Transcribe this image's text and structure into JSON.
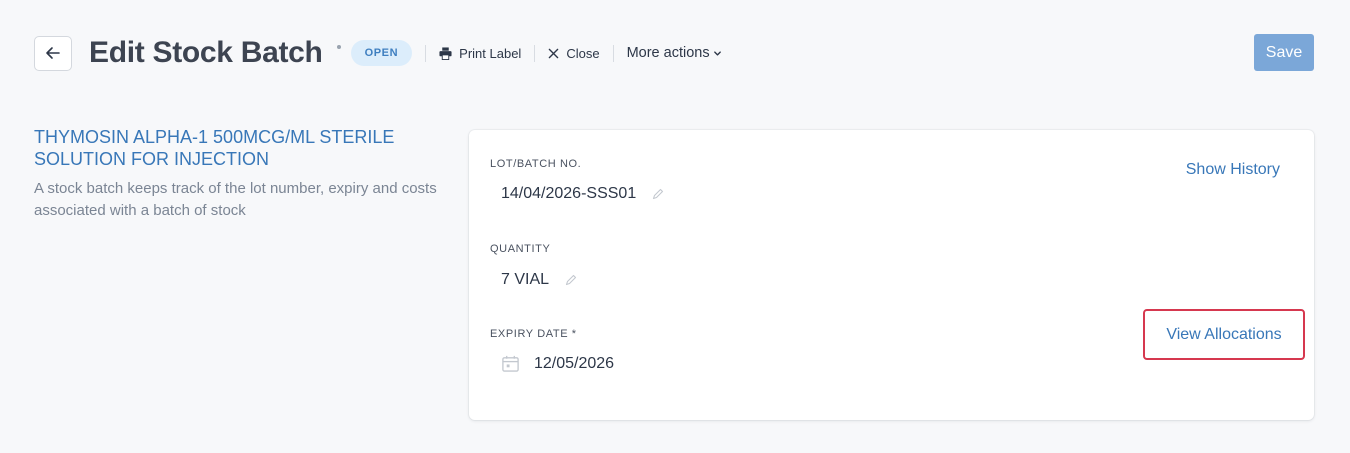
{
  "header": {
    "title": "Edit Stock Batch",
    "status": "OPEN",
    "actions": {
      "print_label": "Print Label",
      "close": "Close",
      "more_actions": "More actions"
    },
    "save_label": "Save"
  },
  "product": {
    "name": "THYMOSIN ALPHA-1 500MCG/ML STERILE SOLUTION FOR INJECTION",
    "description": "A stock batch keeps track of the lot number, expiry and costs associated with a batch of stock"
  },
  "form": {
    "lot": {
      "label": "LOT/BATCH NO.",
      "value": "14/04/2026-SSS01"
    },
    "quantity": {
      "label": "QUANTITY",
      "value": "7 VIAL"
    },
    "expiry": {
      "label": "EXPIRY DATE *",
      "value": "12/05/2026"
    },
    "show_history": "Show History",
    "view_allocations": "View Allocations"
  },
  "colors": {
    "accent": "#3877b8",
    "save_button": "#7ba7d8",
    "badge_bg": "#dcedfb",
    "highlight_border": "#d6384f"
  },
  "icons": {
    "back": "arrow-left-icon",
    "print": "printer-icon",
    "close": "close-icon",
    "more": "chevron-down-icon",
    "edit": "pencil-icon",
    "calendar": "calendar-icon"
  }
}
